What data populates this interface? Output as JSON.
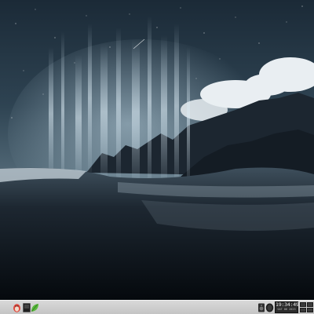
{
  "desktop": {
    "wallpaper_icon": "mountain-beach-night-wallpaper"
  },
  "taskbar": {
    "launchers": [
      {
        "name": "menu",
        "icon": "linux-penguin-icon",
        "color": "#e0453a"
      },
      {
        "name": "terminal",
        "icon": "terminal-icon",
        "color": "#202020"
      },
      {
        "name": "file-manager",
        "icon": "leaf-icon",
        "color": "#58b83a"
      }
    ],
    "tray": {
      "volume_icon": "speaker-icon",
      "display_icon": "monitor-icon"
    },
    "clock": {
      "time": "19:34:49",
      "date": "SAT 06 2023"
    }
  }
}
